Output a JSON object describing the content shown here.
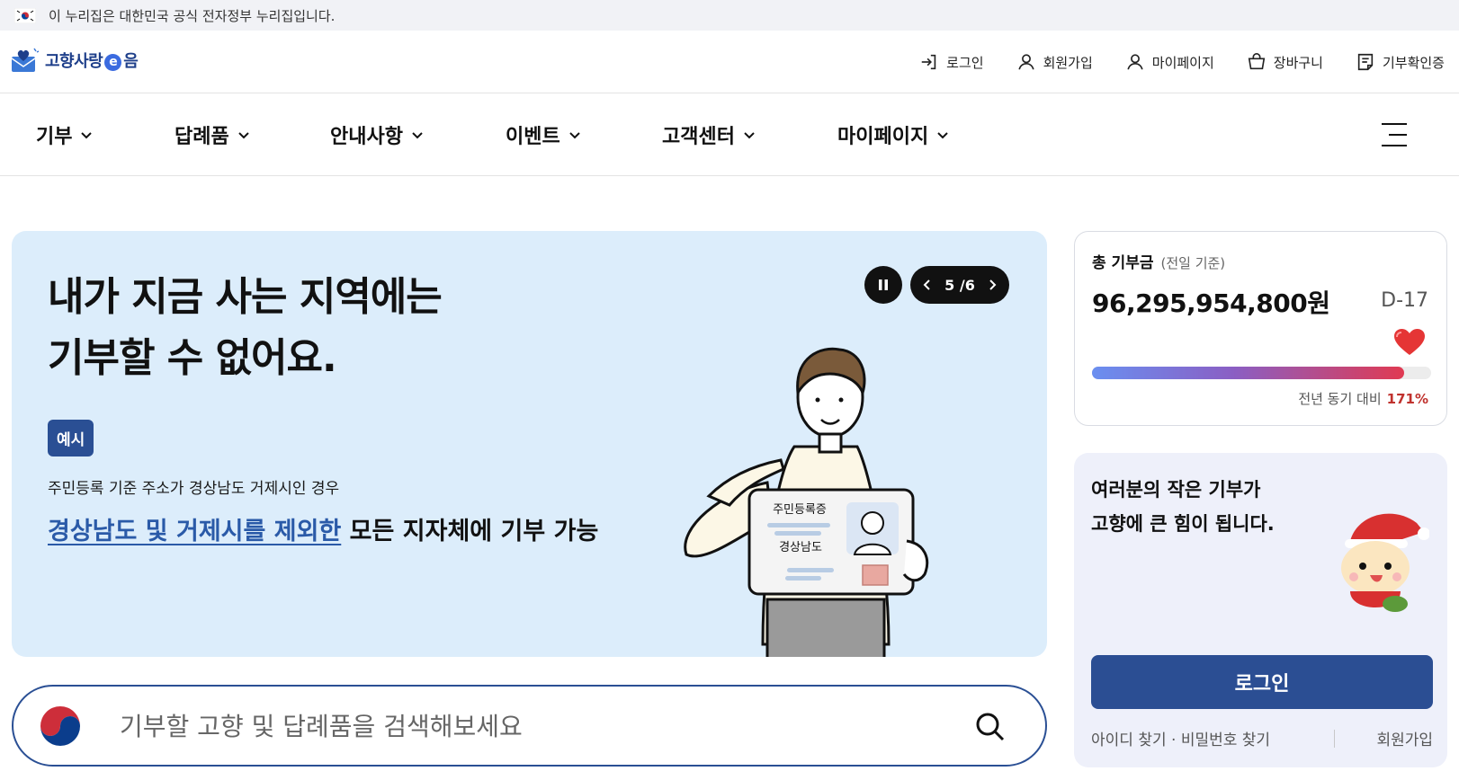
{
  "gov_banner": {
    "text": "이 누리집은 대한민국 공식 전자정부 누리집입니다.",
    "icon": "korea-flag-icon"
  },
  "logo": {
    "part1": "고향사랑",
    "e": "e",
    "part2": "음"
  },
  "util_nav": [
    {
      "label": "로그인",
      "icon": "login-icon"
    },
    {
      "label": "회원가입",
      "icon": "user-icon"
    },
    {
      "label": "마이페이지",
      "icon": "user-icon"
    },
    {
      "label": "장바구니",
      "icon": "cart-icon"
    },
    {
      "label": "기부확인증",
      "icon": "certificate-icon"
    }
  ],
  "gnb": [
    {
      "label": "기부"
    },
    {
      "label": "답례품"
    },
    {
      "label": "안내사항"
    },
    {
      "label": "이벤트"
    },
    {
      "label": "고객센터"
    },
    {
      "label": "마이페이지"
    }
  ],
  "hero": {
    "title_line1": "내가 지금 사는 지역에는",
    "title_line2": "기부할 수 없어요.",
    "badge": "예시",
    "desc": "주민등록 기준 주소가 경상남도 거제시인 경우",
    "main_link": "경상남도 및 거제시를 제외한",
    "main_rest": " 모든 지자체에 기부 가능",
    "card_title": "주민등록증",
    "card_region": "경상남도",
    "pager": {
      "current": "5",
      "total": "/6"
    }
  },
  "search": {
    "placeholder": "기부할 고향 및 답례품을 검색해보세요"
  },
  "donation": {
    "label": "총 기부금",
    "basis": "(전일 기준)",
    "amount": "96,295,954,800원",
    "dday": "D-17",
    "progress": 0.92,
    "yoy_label": "전년 동기 대비",
    "yoy_value": "171%"
  },
  "login_box": {
    "msg_line1": "여러분의 작은 기부가",
    "msg_line2": "고향에 큰 힘이 됩니다.",
    "login_button": "로그인",
    "find_link": "아이디 찾기 · 비밀번호 찾기",
    "signup_link": "회원가입"
  },
  "colors": {
    "brand": "#2b4e93",
    "hero_bg": "#dcedfb",
    "accent_red": "#c0322e"
  }
}
